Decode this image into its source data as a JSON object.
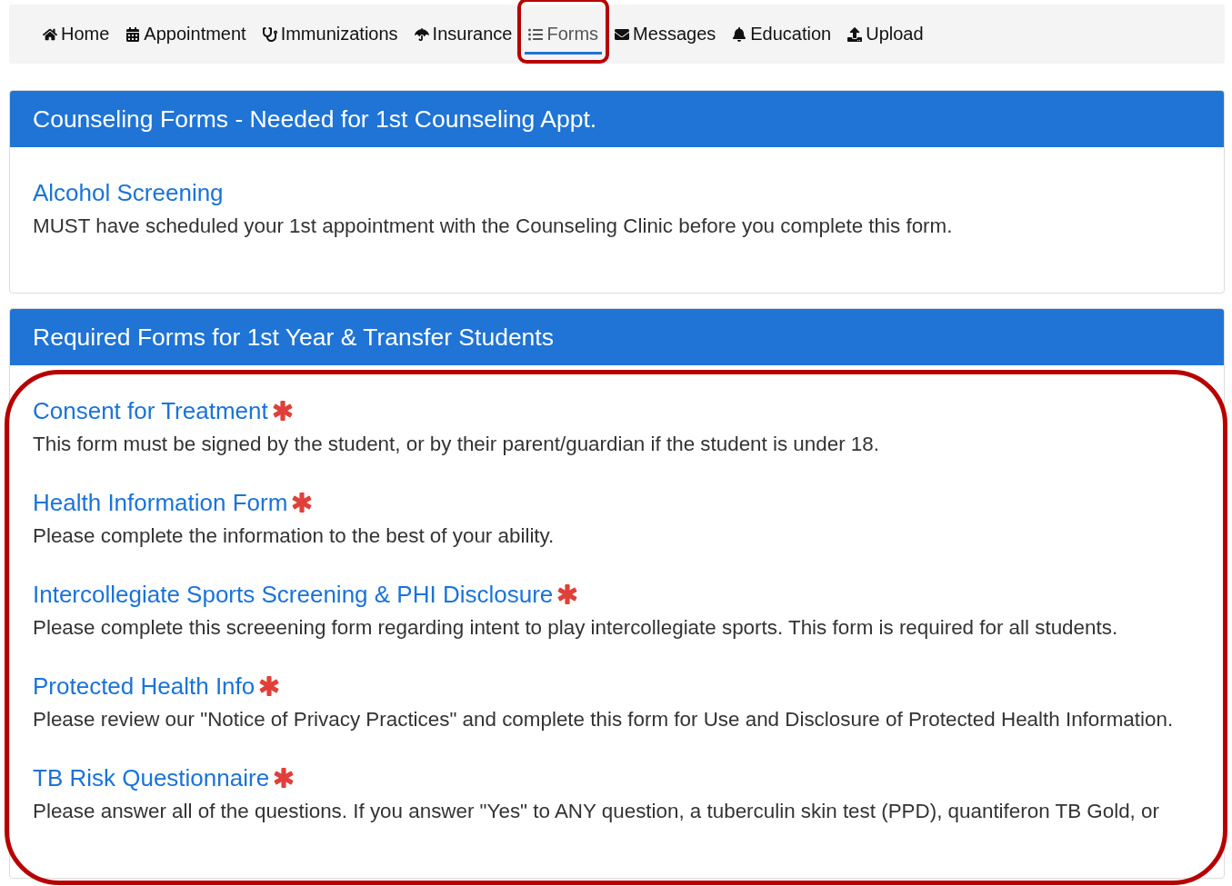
{
  "nav": {
    "items": [
      {
        "label": "Home",
        "selected": false
      },
      {
        "label": "Appointment",
        "selected": false
      },
      {
        "label": "Immunizations",
        "selected": false
      },
      {
        "label": "Insurance",
        "selected": false
      },
      {
        "label": "Forms",
        "selected": true
      },
      {
        "label": "Messages",
        "selected": false
      },
      {
        "label": "Education",
        "selected": false
      },
      {
        "label": "Upload",
        "selected": false
      }
    ]
  },
  "panels": [
    {
      "title": "Counseling Forms - Needed for 1st Counseling Appt.",
      "highlighted": false,
      "forms": [
        {
          "title": "Alcohol Screening",
          "required": false,
          "description": "MUST have scheduled your 1st appointment with the Counseling Clinic before you complete this form."
        }
      ]
    },
    {
      "title": "Required Forms for 1st Year & Transfer Students",
      "highlighted": true,
      "forms": [
        {
          "title": "Consent for Treatment",
          "required": true,
          "description": "This form must be signed by the student, or by their parent/guardian if the student is under 18."
        },
        {
          "title": "Health Information Form",
          "required": true,
          "description": "Please complete the information to the best of your ability."
        },
        {
          "title": "Intercollegiate Sports Screening & PHI Disclosure",
          "required": true,
          "description": "Please complete this screeening form regarding intent to play intercollegiate sports. This form is required for all students."
        },
        {
          "title": "Protected Health Info",
          "required": true,
          "description": "Please review our \"Notice of Privacy Practices\" and complete this form for Use and Disclosure of Protected Health Information."
        },
        {
          "title": "TB Risk Questionnaire",
          "required": true,
          "description": "Please answer all of the questions. If you answer \"Yes\" to ANY question, a tuberculin skin test (PPD), quantiferon TB Gold, or"
        }
      ]
    }
  ]
}
